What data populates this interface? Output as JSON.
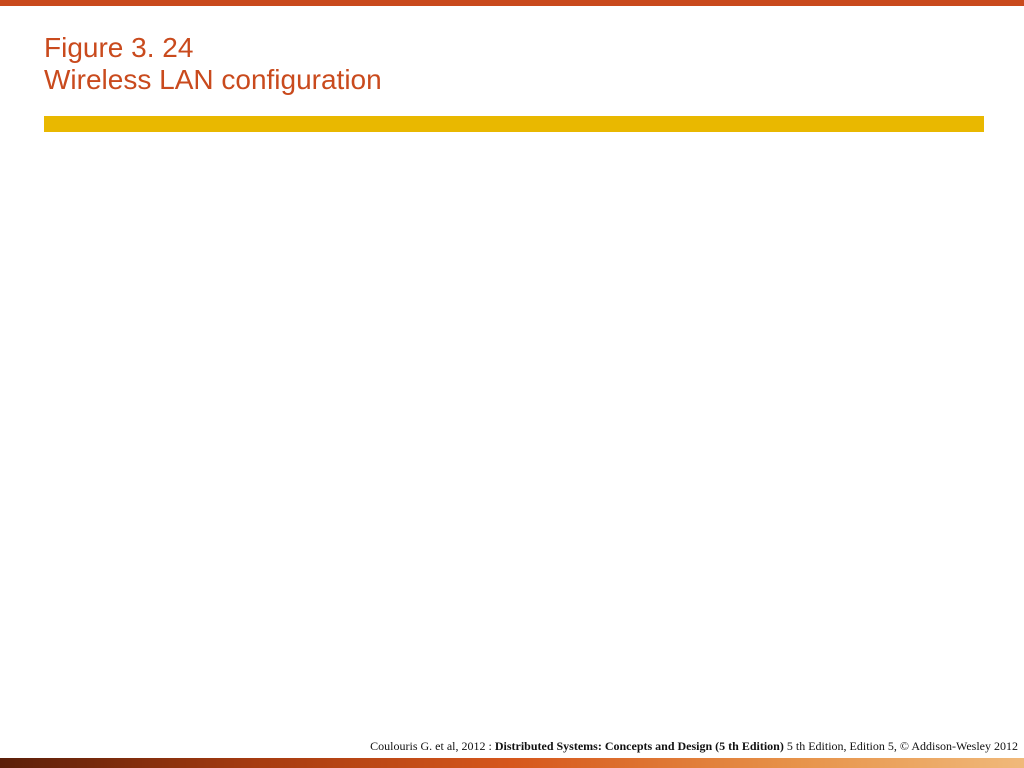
{
  "colors": {
    "orange": "#c94a1d",
    "yellow": "#e9b800"
  },
  "title": {
    "line1": "Figure 3. 24",
    "line2": "Wireless LAN configuration"
  },
  "footer": {
    "prefix": "Coulouris G. et al, 2012 : ",
    "bold": "Distributed Systems: Concepts and Design (5 th Edition)",
    "suffix": " 5 th Edition, Edition 5, © Addison-Wesley 2012"
  }
}
